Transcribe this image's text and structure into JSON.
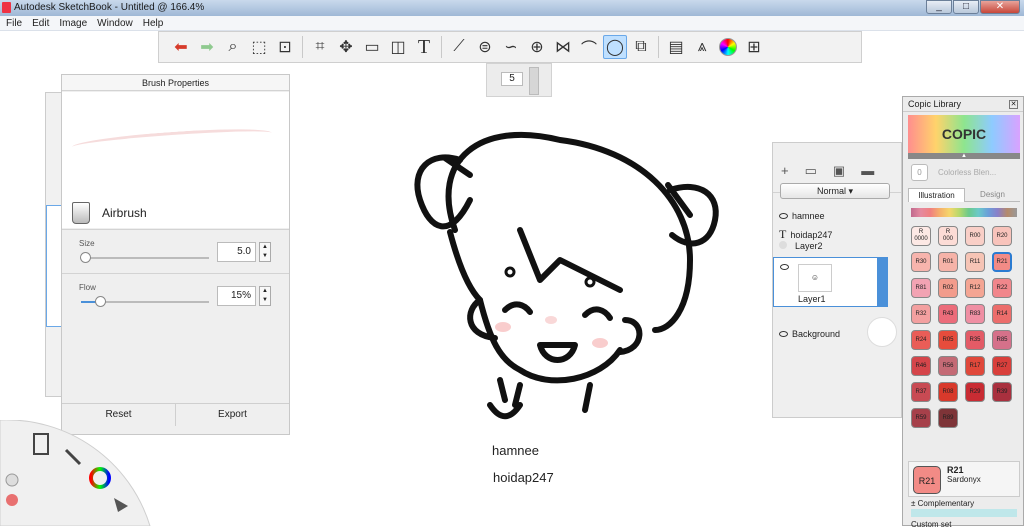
{
  "window": {
    "title": "Autodesk SketchBook - Untitled @ 166.4%",
    "min": "_",
    "max": "□",
    "close": "✕"
  },
  "menu": [
    "File",
    "Edit",
    "Image",
    "Window",
    "Help"
  ],
  "toolbar": {
    "icons": [
      "undo-icon",
      "redo-icon",
      "zoom-icon",
      "select-icon",
      "transform-icon",
      "crop-icon",
      "lasso-icon",
      "distort-icon",
      "fill-icon",
      "text-icon",
      "ruler-icon",
      "ellipse-guide-icon",
      "french-curve-icon",
      "perspective-icon",
      "symmetry-icon",
      "stroke-icon",
      "predictive-stroke-icon",
      "shape-icon",
      "copic-icon",
      "brush-library-icon",
      "color-wheel-icon",
      "grid-icon"
    ],
    "active": "predictive-stroke-icon"
  },
  "brush_size_box": {
    "value": "5"
  },
  "brush_properties": {
    "title": "Brush Properties",
    "brush_name": "Airbrush",
    "size": {
      "label": "Size",
      "value": "5.0",
      "level": 0.03
    },
    "flow": {
      "label": "Flow",
      "value": "15%",
      "level": 0.15
    },
    "reset": "Reset",
    "export": "Export"
  },
  "canvas": {
    "text1": "hamnee",
    "text2": "hoidap247"
  },
  "layers": {
    "blend_mode": "Normal",
    "items": [
      {
        "name": "hamnee",
        "type": "text"
      },
      {
        "name": "hoidap247",
        "type": "text"
      },
      {
        "name": "Layer2",
        "type": "layer"
      },
      {
        "name": "Layer1",
        "type": "layer",
        "selected": true
      },
      {
        "name": "Background",
        "type": "background"
      }
    ]
  },
  "copic": {
    "title": "Copic Library",
    "logo": "COPIC",
    "colorless": {
      "code": "0",
      "label": "Colorless Blen..."
    },
    "tabs": [
      "Illustration",
      "Design"
    ],
    "swatches": [
      {
        "code": "R\n0000",
        "color": "#fde9e5"
      },
      {
        "code": "R\n000",
        "color": "#fcdcd6"
      },
      {
        "code": "R00",
        "color": "#f9cfc7"
      },
      {
        "code": "R20",
        "color": "#f8c3bb"
      },
      {
        "code": "R30",
        "color": "#f7b4ad"
      },
      {
        "code": "R01",
        "color": "#f6b3a8"
      },
      {
        "code": "R11",
        "color": "#f6c4b5"
      },
      {
        "code": "R21",
        "color": "#f28b86"
      },
      {
        "code": "R81",
        "color": "#f2a3b3"
      },
      {
        "code": "R02",
        "color": "#f29c8c"
      },
      {
        "code": "R12",
        "color": "#f4a593"
      },
      {
        "code": "R22",
        "color": "#f1868b"
      },
      {
        "code": "R32",
        "color": "#f3a0a0"
      },
      {
        "code": "R43",
        "color": "#ec6c7a"
      },
      {
        "code": "R83",
        "color": "#ef8fa3"
      },
      {
        "code": "R14",
        "color": "#ec6d6b"
      },
      {
        "code": "R24",
        "color": "#e95d57"
      },
      {
        "code": "R05",
        "color": "#e74c3c"
      },
      {
        "code": "R35",
        "color": "#e35b66"
      },
      {
        "code": "R85",
        "color": "#d5718a"
      },
      {
        "code": "R46",
        "color": "#d5454a"
      },
      {
        "code": "R56",
        "color": "#c46a75"
      },
      {
        "code": "R17",
        "color": "#e0483a"
      },
      {
        "code": "R27",
        "color": "#d93f3b"
      },
      {
        "code": "R37",
        "color": "#c84a53"
      },
      {
        "code": "R08",
        "color": "#d8392b"
      },
      {
        "code": "R29",
        "color": "#c92c33"
      },
      {
        "code": "R39",
        "color": "#a9303e"
      },
      {
        "code": "R59",
        "color": "#a6404a"
      },
      {
        "code": "R89",
        "color": "#7e3438"
      }
    ],
    "selected": {
      "code": "R21",
      "name": "R21",
      "desc": "Sardonyx"
    },
    "complementary": "Complementary",
    "custom": "Custom set"
  }
}
